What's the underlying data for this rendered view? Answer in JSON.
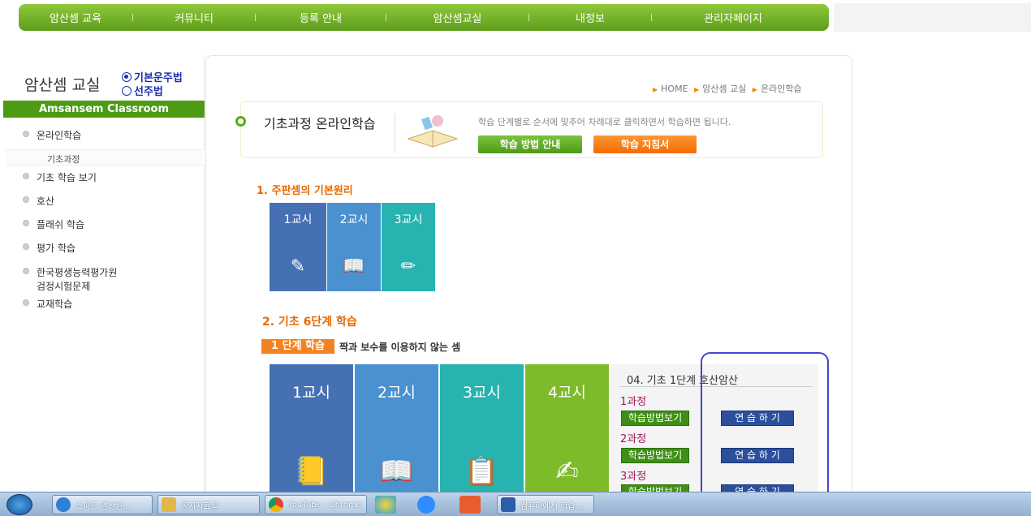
{
  "topnav": {
    "items": [
      "암산셈 교육",
      "커뮤니티",
      "등록 안내",
      "암산셈교실",
      "내정보",
      "관리자페이지"
    ]
  },
  "sidebar": {
    "title": "암산셈 교실",
    "radio_basic": "기본운주법",
    "radio_first": "선주법",
    "banner": "Amsansem Classroom",
    "items": [
      "온라인학습",
      "기초 학습 보기",
      "호산",
      "플래쉬 학습",
      "평가 학습",
      "한국평생능력평가원",
      "교재학습"
    ],
    "item_6_line2": "검정시험문제",
    "sub_item": "기초과정"
  },
  "breadcrumb": {
    "home": "HOME",
    "level1": "암산셈 교실",
    "level2": "온라인학습"
  },
  "header": {
    "title": "기초과정 온라인학습",
    "description": "학습 단계별로 순서에 맞추어 차례대로 클릭하면서 학습하면 됩니다.",
    "btn_method": "학습 방법 안내",
    "btn_guide": "학습 지침서"
  },
  "section1": {
    "title": "1. 주판셈의 기본원리",
    "tiles": [
      "1교시",
      "2교시",
      "3교시"
    ]
  },
  "section2": {
    "title": "2. 기초 6단계 학습",
    "stage_badge": "1 단계 학습",
    "stage_desc": "짝과 보수를 이용하지 않는 셈",
    "tiles": [
      "1교시",
      "2교시",
      "3교시",
      "4교시"
    ]
  },
  "practice": {
    "title": "04. 기초 1단계 호산암산",
    "courses": [
      "1과정",
      "2과정",
      "3과정"
    ],
    "method_btn": "학습방법보기",
    "practice_btn": "연 습 하 기"
  },
  "taskbar": {
    "items": [
      "스피드 암산셈...",
      "공지자료실",
      "YouTube - Chrome",
      "컴퓨터에서 학습..."
    ]
  },
  "colors": {
    "nav_green": "#6aad22",
    "tile1": "#4670b4",
    "tile2": "#4a91cf",
    "tile3": "#27b3b0",
    "tile4": "#7dbb2b",
    "orange": "#f58220",
    "annotation": "#4646c9"
  }
}
